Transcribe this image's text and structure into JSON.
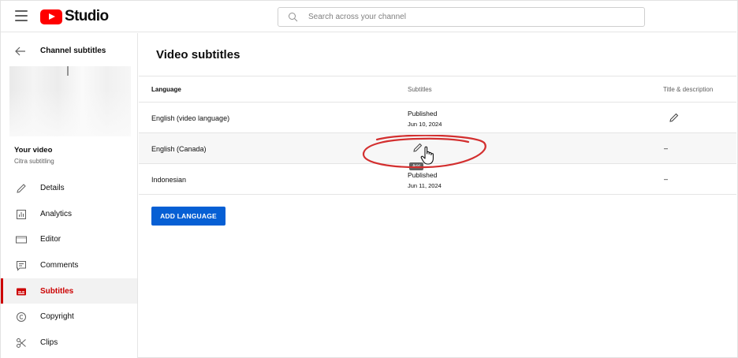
{
  "app": {
    "logo_text": "Studio"
  },
  "search": {
    "placeholder": "Search across your channel"
  },
  "sidebar": {
    "title": "Channel subtitles",
    "video_label": "Your video",
    "video_subtitle": "Citra subtitling",
    "items": [
      {
        "label": "Details",
        "icon": "pencil-icon"
      },
      {
        "label": "Analytics",
        "icon": "analytics-icon"
      },
      {
        "label": "Editor",
        "icon": "editor-icon"
      },
      {
        "label": "Comments",
        "icon": "comments-icon"
      },
      {
        "label": "Subtitles",
        "icon": "subtitles-icon",
        "active": true
      },
      {
        "label": "Copyright",
        "icon": "copyright-icon"
      },
      {
        "label": "Clips",
        "icon": "scissors-icon"
      }
    ]
  },
  "main": {
    "title": "Video subtitles",
    "columns": {
      "language": "Language",
      "subtitles": "Subtitles",
      "title_desc": "Title & description"
    },
    "rows": [
      {
        "language": "English (video language)",
        "status": "Published",
        "date": "Jun 10, 2024",
        "title_desc": ""
      },
      {
        "language": "English (Canada)",
        "status": "",
        "date": "",
        "title_desc": "–"
      },
      {
        "language": "Indonesian",
        "status": "Published",
        "date": "Jun 11, 2024",
        "title_desc": "–"
      }
    ],
    "tooltip": "Add",
    "add_button": "ADD LANGUAGE"
  },
  "colors": {
    "accent": "#065fd4",
    "brand": "#ff0000",
    "active": "#cc0000",
    "annotation": "#d32f2f"
  }
}
